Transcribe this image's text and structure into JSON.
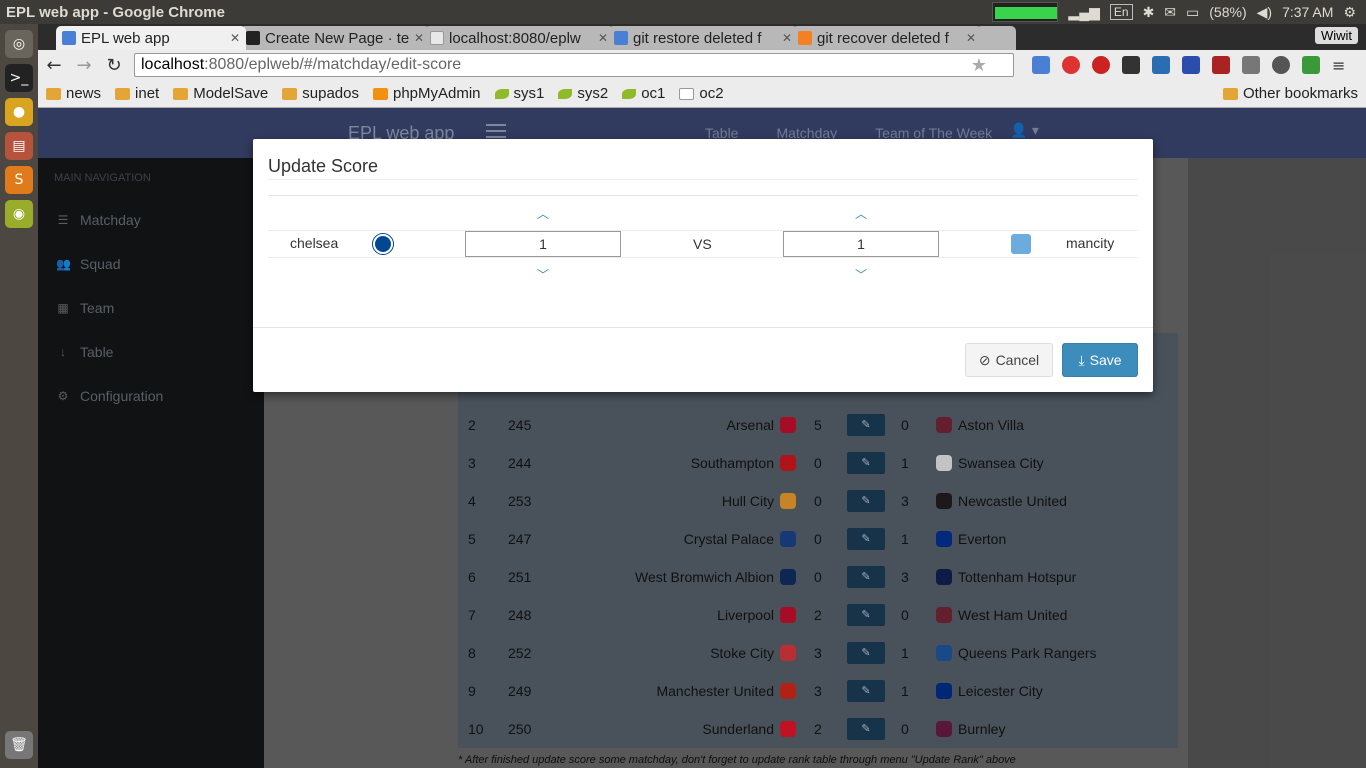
{
  "os": {
    "window_title": "EPL web app - Google Chrome",
    "keyboard": "En",
    "battery": "(58%)",
    "time": "7:37 AM"
  },
  "browser": {
    "tabs": [
      {
        "label": "EPL web app",
        "favicon_color": "#4a7fd6"
      },
      {
        "label": "Create New Page · te",
        "favicon_color": "#222222"
      },
      {
        "label": "localhost:8080/eplw",
        "favicon_color": "#e8e8e8"
      },
      {
        "label": "git restore deleted f",
        "favicon_color": "#4a7fd6"
      },
      {
        "label": "git recover deleted f",
        "favicon_color": "#f48024"
      }
    ],
    "extension_button": "Wiwit",
    "url_host": "localhost",
    "url_rest": ":8080/eplweb/#/matchday/edit-score",
    "bookmarks": [
      {
        "label": "news",
        "icon": "folder-icon"
      },
      {
        "label": "inet",
        "icon": "folder-icon"
      },
      {
        "label": "ModelSave",
        "icon": "folder-icon"
      },
      {
        "label": "supados",
        "icon": "folder-icon"
      },
      {
        "label": "phpMyAdmin",
        "icon": "pma-icon"
      },
      {
        "label": "sys1",
        "icon": "leaf-icon"
      },
      {
        "label": "sys2",
        "icon": "leaf-icon"
      },
      {
        "label": "oc1",
        "icon": "leaf-icon"
      },
      {
        "label": "oc2",
        "icon": "page-icon"
      }
    ],
    "other_bookmarks": "Other bookmarks"
  },
  "app": {
    "brand": "EPL web app",
    "topnav": [
      "Table",
      "Matchday",
      "Team of The Week"
    ],
    "sidebar_header": "MAIN NAVIGATION",
    "sidebar": [
      {
        "label": "Matchday",
        "icon": "list-icon"
      },
      {
        "label": "Squad",
        "icon": "users-icon"
      },
      {
        "label": "Team",
        "icon": "table-icon"
      },
      {
        "label": "Table",
        "icon": "sort-icon"
      },
      {
        "label": "Configuration",
        "icon": "gear-icon"
      }
    ],
    "matches": [
      {
        "no": "2",
        "id": "245",
        "home": "Arsenal",
        "home_score": "5",
        "away_score": "0",
        "away": "Aston Villa",
        "home_color": "#c8102e",
        "away_color": "#7a263a"
      },
      {
        "no": "3",
        "id": "244",
        "home": "Southampton",
        "home_score": "0",
        "away_score": "1",
        "away": "Swansea City",
        "home_color": "#d71920",
        "away_color": "#eeeeee"
      },
      {
        "no": "4",
        "id": "253",
        "home": "Hull City",
        "home_score": "0",
        "away_score": "3",
        "away": "Newcastle United",
        "home_color": "#f5a12d",
        "away_color": "#241f20"
      },
      {
        "no": "5",
        "id": "247",
        "home": "Crystal Palace",
        "home_score": "0",
        "away_score": "1",
        "away": "Everton",
        "home_color": "#1b458f",
        "away_color": "#003399"
      },
      {
        "no": "6",
        "id": "251",
        "home": "West Bromwich Albion",
        "home_score": "0",
        "away_score": "3",
        "away": "Tottenham Hotspur",
        "home_color": "#122f67",
        "away_color": "#132257"
      },
      {
        "no": "7",
        "id": "248",
        "home": "Liverpool",
        "home_score": "2",
        "away_score": "0",
        "away": "West Ham United",
        "home_color": "#c8102e",
        "away_color": "#7a263a"
      },
      {
        "no": "8",
        "id": "252",
        "home": "Stoke City",
        "home_score": "3",
        "away_score": "1",
        "away": "Queens Park Rangers",
        "home_color": "#e03a3e",
        "away_color": "#1d5ba4"
      },
      {
        "no": "9",
        "id": "249",
        "home": "Manchester United",
        "home_score": "3",
        "away_score": "1",
        "away": "Leicester City",
        "home_color": "#da291c",
        "away_color": "#003090"
      },
      {
        "no": "10",
        "id": "250",
        "home": "Sunderland",
        "home_score": "2",
        "away_score": "0",
        "away": "Burnley",
        "home_color": "#eb172b",
        "away_color": "#6c1d45"
      }
    ],
    "footnote": "* After finished update score some matchday, don't forget to update rank table through menu \"Update Rank\" above"
  },
  "modal": {
    "title": "Update Score",
    "home_team": "chelsea",
    "away_team": "mancity",
    "home_score": "1",
    "away_score": "1",
    "vs": "VS",
    "cancel_label": "Cancel",
    "save_label": "Save",
    "home_crest_color": "#034694",
    "away_crest_color": "#6cabdd",
    "accent": "#3c8dbc"
  }
}
